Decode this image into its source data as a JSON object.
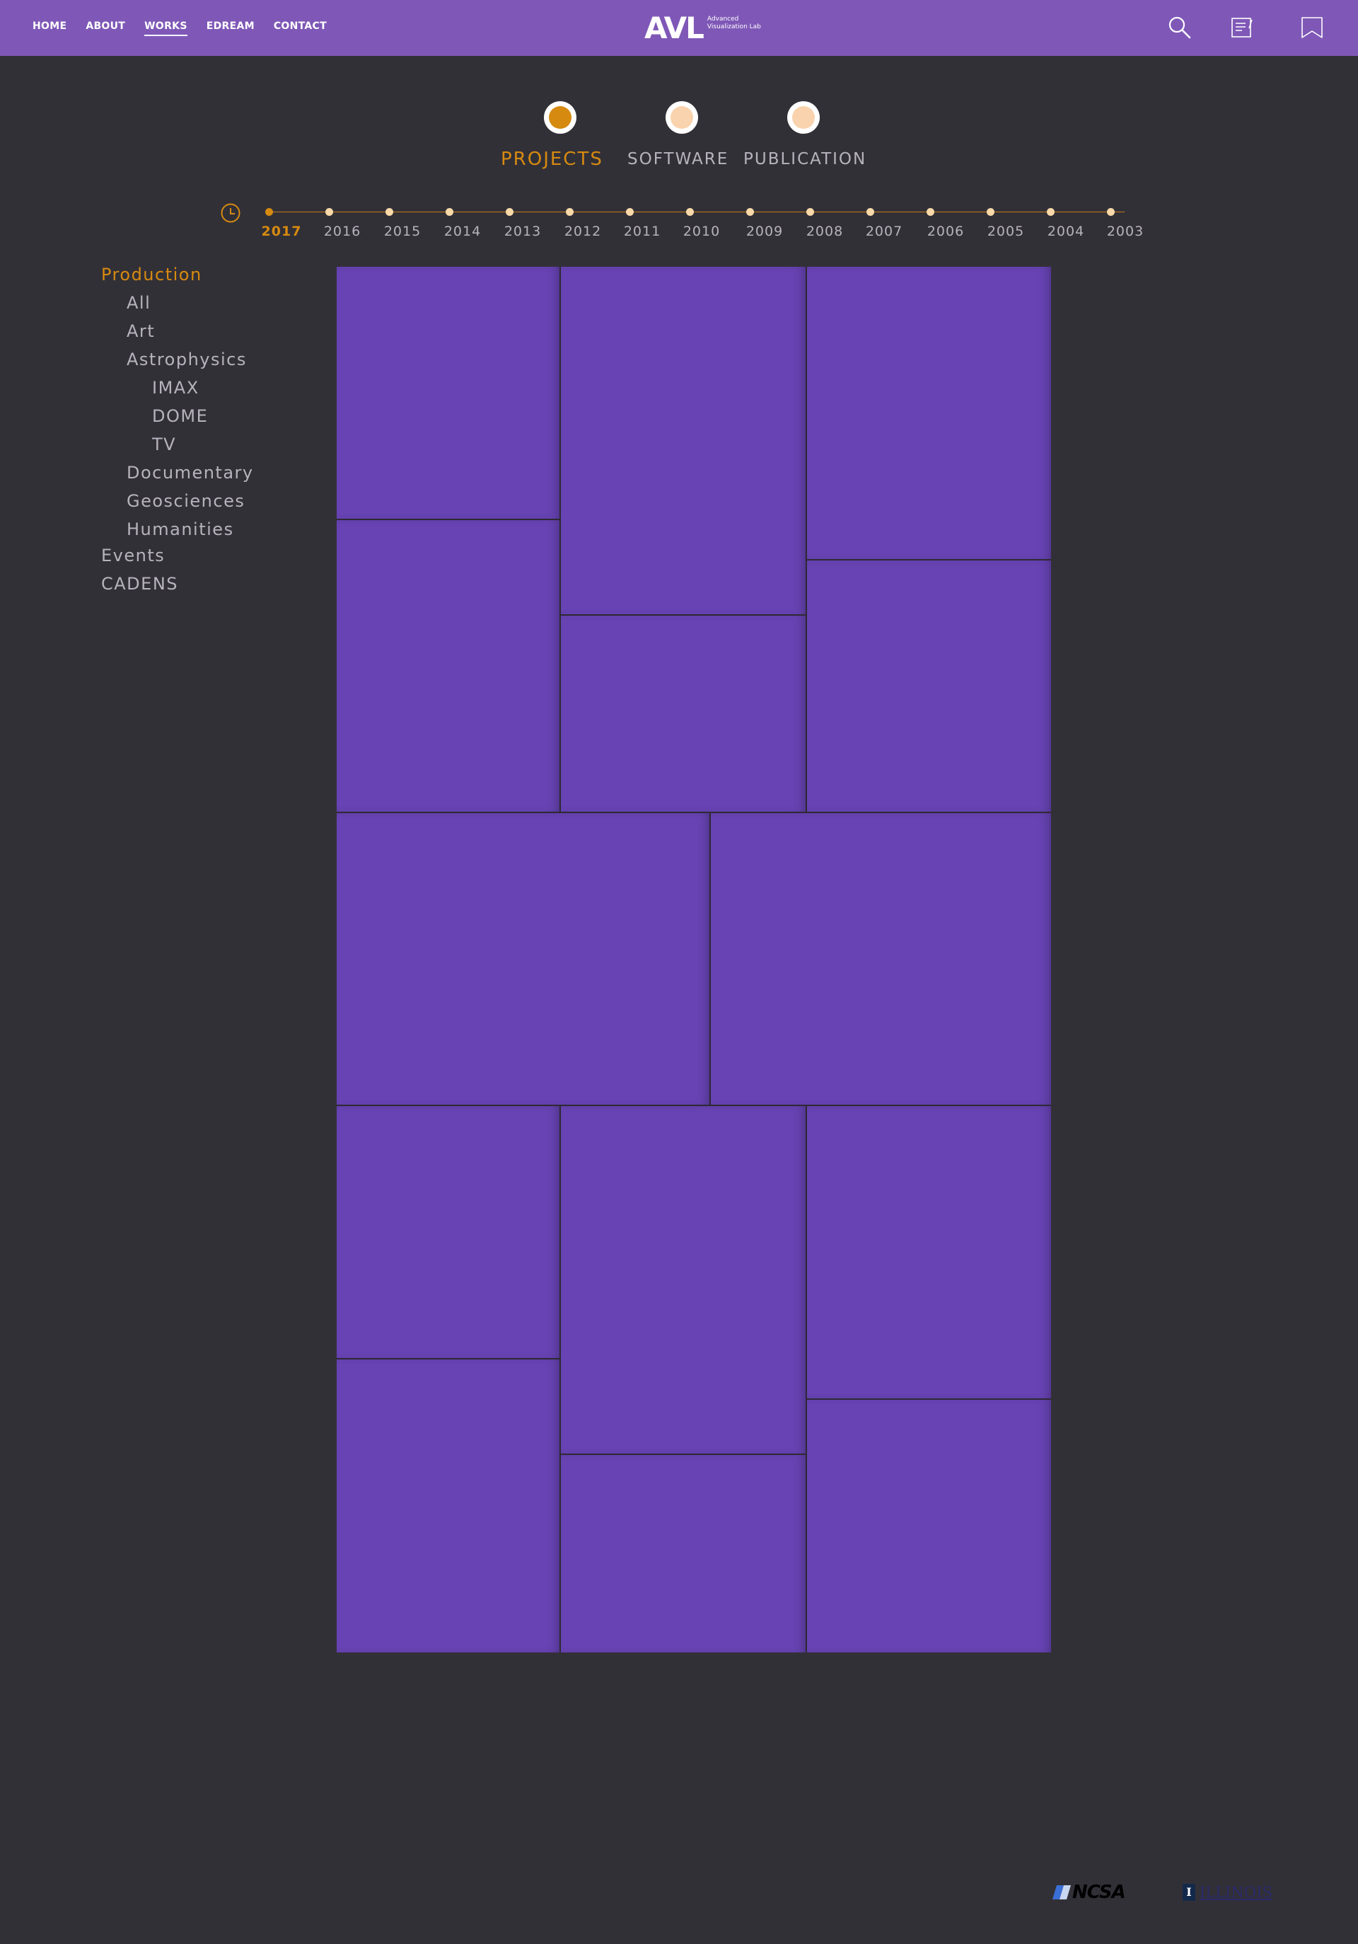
{
  "colors": {
    "header_bg": "#7f58b7",
    "page_bg": "#323037",
    "accent": "#d68a10",
    "tile": "#6743b3",
    "inactive_text": "#b7b3bd",
    "timeline_dot": "#f9d9a9"
  },
  "nav": {
    "items": [
      {
        "label": "HOME"
      },
      {
        "label": "ABOUT"
      },
      {
        "label": "WORKS",
        "active": true
      },
      {
        "label": "EDREAM"
      },
      {
        "label": "CONTACT"
      }
    ]
  },
  "logo": {
    "mark": "AVL",
    "sub_line1": "Advanced",
    "sub_line2": "Visualization Lab"
  },
  "header_icons": [
    "search-icon",
    "notes-icon",
    "bookmark-icon"
  ],
  "categories": [
    {
      "label": "PROJECTS",
      "active": true
    },
    {
      "label": "SOFTWARE",
      "active": false
    },
    {
      "label": "PUBLICATION",
      "active": false
    }
  ],
  "timeline": {
    "icon": "clock-icon",
    "years": [
      "2017",
      "2016",
      "2015",
      "2014",
      "2013",
      "2012",
      "2011",
      "2010",
      "2009",
      "2008",
      "2007",
      "2006",
      "2005",
      "2004",
      "2003"
    ],
    "active_year": "2017"
  },
  "sidebar": {
    "production": "Production",
    "all": "All",
    "art": "Art",
    "astrophysics": "Astrophysics",
    "imax": "IMAX",
    "dome": "DOME",
    "tv": "TV",
    "documentary": "Documentary",
    "geosciences": "Geosciences",
    "humanities": "Humanities",
    "events": "Events",
    "cadens": "CADENS"
  },
  "footer": {
    "ncsa": "NCSA",
    "illinois": "ILLINOIS",
    "illinois_mark": "I"
  }
}
